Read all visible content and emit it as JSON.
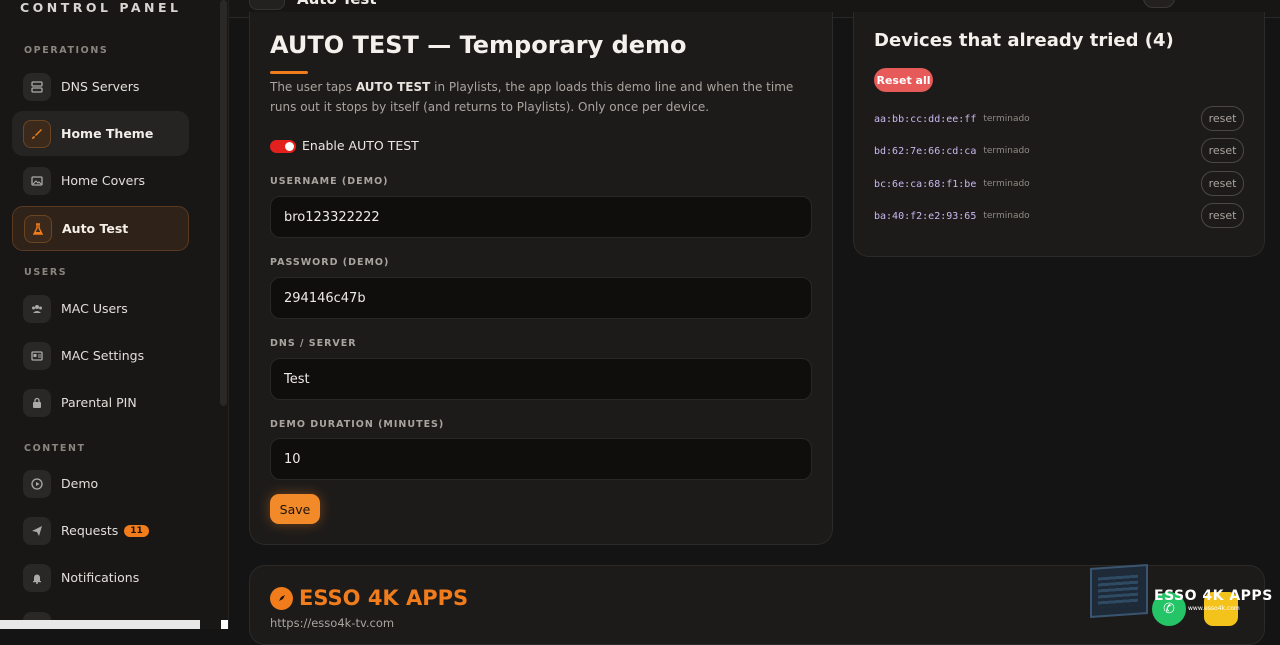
{
  "sidebar": {
    "brand": "CONTROL PANEL",
    "sections": [
      {
        "label": "OPERATIONS"
      },
      {
        "label": "USERS"
      },
      {
        "label": "CONTENT"
      }
    ],
    "items": [
      {
        "label": "DNS Servers",
        "icon": "server-icon"
      },
      {
        "label": "Home Theme",
        "icon": "brush-icon"
      },
      {
        "label": "Home Covers",
        "icon": "image-icon"
      },
      {
        "label": "Auto Test",
        "icon": "flask-icon"
      },
      {
        "label": "MAC Users",
        "icon": "users-icon"
      },
      {
        "label": "MAC Settings",
        "icon": "id-card-icon"
      },
      {
        "label": "Parental PIN",
        "icon": "lock-icon"
      },
      {
        "label": "Demo",
        "icon": "play-icon"
      },
      {
        "label": "Requests",
        "icon": "send-icon",
        "badge": "11"
      },
      {
        "label": "Notifications",
        "icon": "bell-icon"
      }
    ]
  },
  "topbar": {
    "title": "Auto Test"
  },
  "autotest": {
    "title": "AUTO TEST — Temporary demo",
    "desc_pre": "The user taps ",
    "desc_bold": "AUTO TEST",
    "desc_post": " in Playlists, the app loads this demo line and when the time runs out it stops by itself (and returns to Playlists). Only once per device.",
    "toggle_label": "Enable AUTO TEST",
    "username_label": "USERNAME (DEMO)",
    "username_value": "bro123322222",
    "password_label": "PASSWORD (DEMO)",
    "password_value": "294146c47b",
    "dns_label": "DNS / SERVER",
    "dns_value": "Test",
    "duration_label": "DEMO DURATION (MINUTES)",
    "duration_value": "10",
    "save_label": "Save"
  },
  "devices": {
    "title": "Devices that already tried (4)",
    "reset_all_label": "Reset all",
    "reset_label": "reset",
    "rows": [
      {
        "mac": "aa:bb:cc:dd:ee:ff",
        "status": "terminado"
      },
      {
        "mac": "bd:62:7e:66:cd:ca",
        "status": "terminado"
      },
      {
        "mac": "bc:6e:ca:68:f1:be",
        "status": "terminado"
      },
      {
        "mac": "ba:40:f2:e2:93:65",
        "status": "terminado"
      }
    ]
  },
  "footer": {
    "brand": "ESSO 4K APPS",
    "url": "https://esso4k-tv.com"
  },
  "promo": {
    "text": "ESSO 4K APPS",
    "sub": "www.esso4k.com"
  },
  "colors": {
    "accent": "#f07c1c",
    "danger": "#e65a5a",
    "toggle": "#e2201e"
  }
}
